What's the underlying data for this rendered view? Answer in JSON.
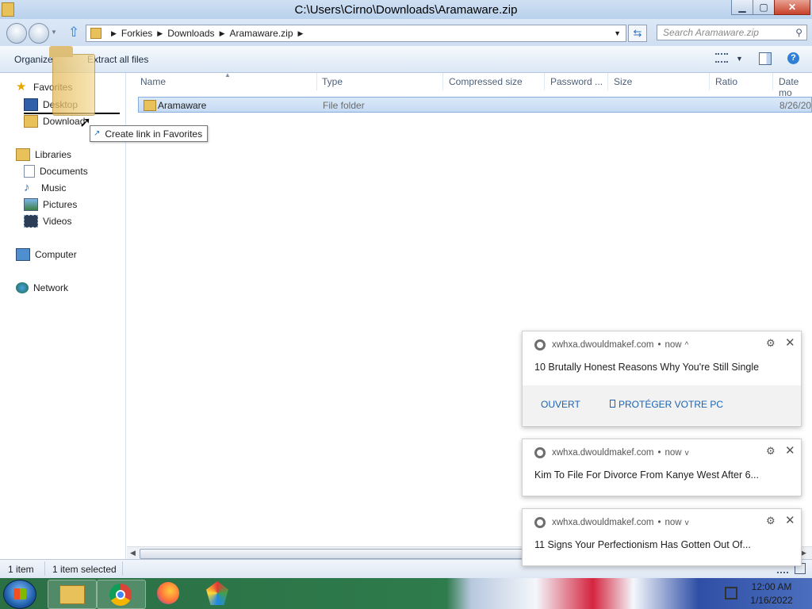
{
  "window": {
    "title": "C:\\Users\\Cirno\\Downloads\\Aramaware.zip",
    "min_glyph": "▁",
    "max_glyph": "▢",
    "close_glyph": "✕"
  },
  "address": {
    "breadcrumbs": [
      "Forkies",
      "Downloads",
      "Aramaware.zip"
    ],
    "search_placeholder": "Search Aramaware.zip"
  },
  "toolbar": {
    "organize": "Organize",
    "extract_all": "Extract all files"
  },
  "navpane": {
    "favorites": "Favorites",
    "desktop": "Desktop",
    "downloads": "Download",
    "libraries": "Libraries",
    "documents": "Documents",
    "music": "Music",
    "pictures": "Pictures",
    "videos": "Videos",
    "computer": "Computer",
    "network": "Network"
  },
  "tooltip": {
    "text": "Create link in Favorites"
  },
  "columns": {
    "name": "Name",
    "type": "Type",
    "compressed_size": "Compressed size",
    "password": "Password ...",
    "size": "Size",
    "ratio": "Ratio",
    "date": "Date mo"
  },
  "files": [
    {
      "name": "Aramaware",
      "type": "File folder",
      "date": "8/26/20"
    }
  ],
  "statusbar": {
    "count": "1 item",
    "selected": "1 item selected"
  },
  "notifications": [
    {
      "source": "xwhxa.dwouldmakef.com",
      "time": "now",
      "chevron": "^",
      "title": "10 Brutally Honest Reasons Why You're Still Single",
      "actions": [
        "OUVERT",
        "PROTÉGER VOTRE PC"
      ]
    },
    {
      "source": "xwhxa.dwouldmakef.com",
      "time": "now",
      "chevron": "v",
      "title": "Kim To File For Divorce From Kanye West After 6..."
    },
    {
      "source": "xwhxa.dwouldmakef.com",
      "time": "now",
      "chevron": "v",
      "title": "11 Signs Your Perfectionism Has Gotten Out Of..."
    }
  ],
  "clock": {
    "time": "12:00 AM",
    "date": "1/16/2022"
  },
  "colors": {
    "selection": "#cce0f7",
    "link_blue": "#1a63b5",
    "window_chrome": "#c4d6ee"
  }
}
